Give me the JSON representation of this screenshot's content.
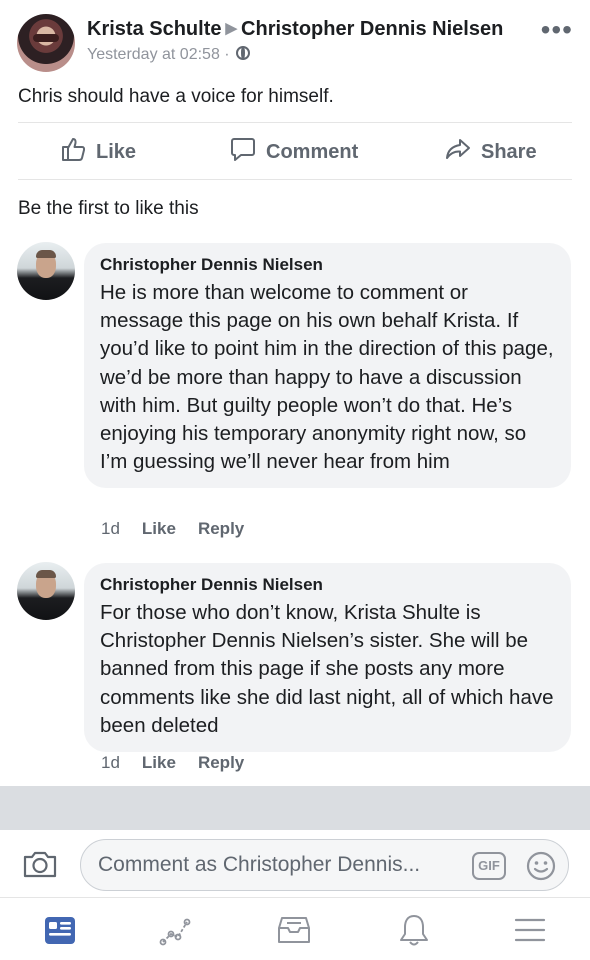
{
  "post": {
    "author": "Krista Schulte",
    "target": "Christopher Dennis Nielsen",
    "timestamp": "Yesterday at 02:58 ·",
    "text": "Chris should have a voice for himself."
  },
  "actions": {
    "like": "Like",
    "comment": "Comment",
    "share": "Share"
  },
  "reactions_text": "Be the first to like this",
  "comments": [
    {
      "name": "Christopher Dennis Nielsen",
      "body": "He is more than welcome to comment or message this page on his own behalf Krista. If you’d like to point him in the direction of this page, we’d be more than happy to have a discussion with him. But guilty people won’t do that. He’s enjoying his temporary anonymity right now, so I’m guessing we’ll never hear from him",
      "age": "1d",
      "like": "Like",
      "reply": "Reply"
    },
    {
      "name": "Christopher Dennis Nielsen",
      "body": "For those who don’t know, Krista Shulte is Christopher Dennis Nielsen’s sister. She will be banned from this page if she posts any more comments like she did last night, all of which have been deleted",
      "age": "1d",
      "like": "Like",
      "reply": "Reply"
    }
  ],
  "compose": {
    "placeholder": "Comment as Christopher Dennis...",
    "gif": "GIF"
  },
  "icons": {
    "header_more": "more-icon",
    "privacy": "globe-icon",
    "camera": "camera-icon",
    "emoji": "emoji-icon",
    "nav": [
      "news-feed-icon",
      "activity-icon",
      "inbox-icon",
      "notifications-icon",
      "menu-icon"
    ]
  },
  "colors": {
    "accent": "#4267b2",
    "secondary_text": "#606770",
    "bubble": "#f2f3f5"
  }
}
